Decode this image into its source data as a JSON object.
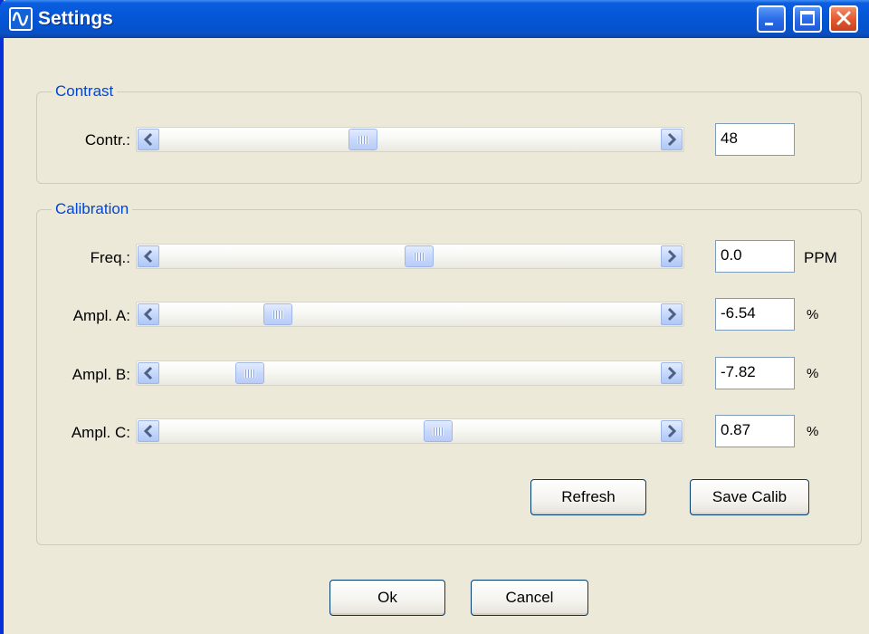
{
  "window": {
    "title": "Settings",
    "colors": {
      "titlebar": "#0453d0",
      "body": "#ece9d8",
      "group_label": "#0046d5"
    },
    "icons": [
      "waveform-icon",
      "minimize-icon",
      "maximize-icon",
      "close-icon"
    ]
  },
  "contrast": {
    "group_title": "Contrast",
    "label": "Contr.:",
    "value": "48",
    "slider_level": 0.4
  },
  "calibration": {
    "group_title": "Calibration",
    "rows": [
      {
        "label": "Freq.:",
        "value": "0.0",
        "unit": "PPM",
        "slider_level": 0.52
      },
      {
        "label": "Ampl. A:",
        "value": "-6.54",
        "unit": "%",
        "slider_level": 0.22
      },
      {
        "label": "Ampl. B:",
        "value": "-7.82",
        "unit": "%",
        "slider_level": 0.16
      },
      {
        "label": "Ampl. C:",
        "value": "0.87",
        "unit": "%",
        "slider_level": 0.56
      }
    ],
    "refresh_label": "Refresh",
    "save_label": "Save Calib"
  },
  "footer": {
    "ok_label": "Ok",
    "cancel_label": "Cancel"
  }
}
